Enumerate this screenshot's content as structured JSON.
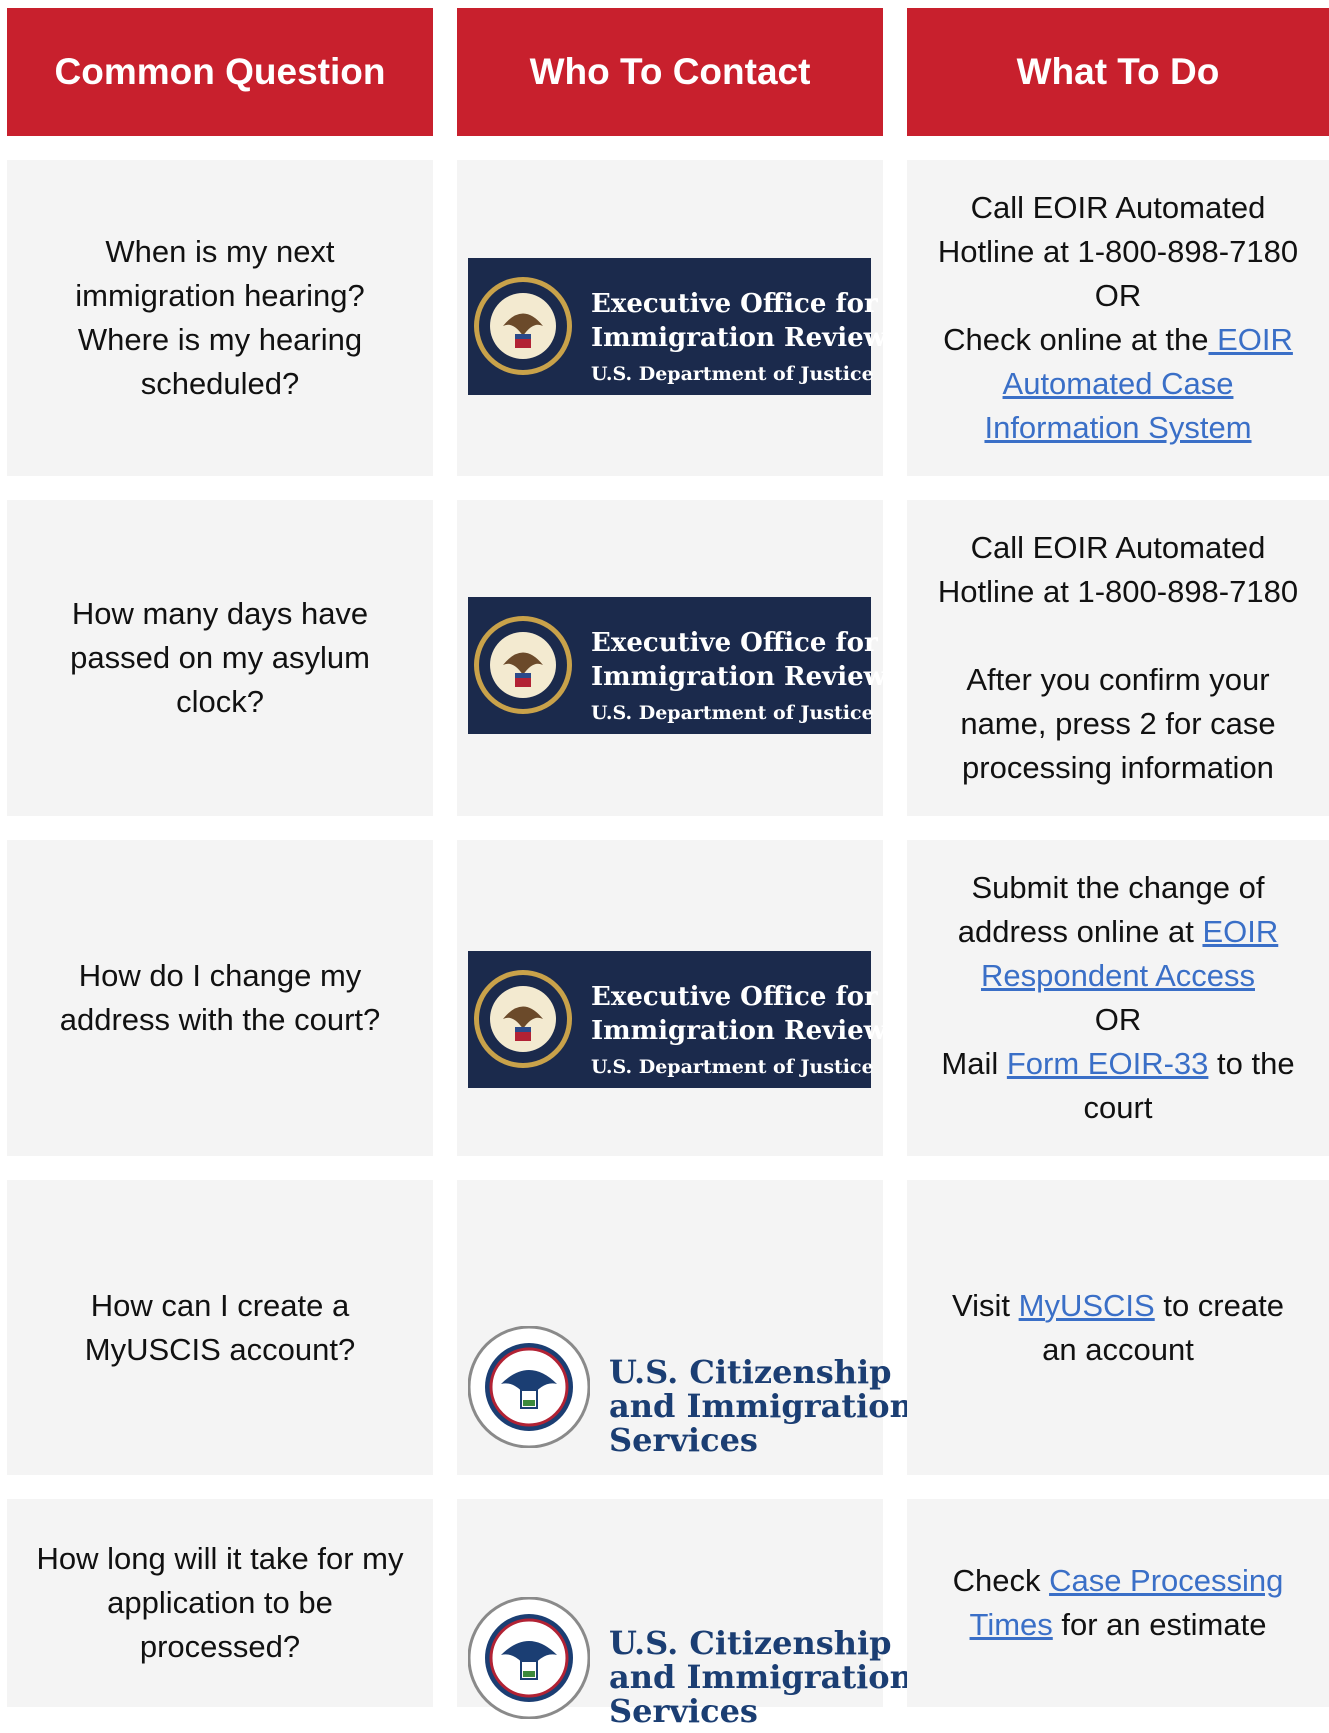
{
  "headers": {
    "question": "Common Question",
    "contact": "Who To Contact",
    "action": "What To Do"
  },
  "logos": {
    "eoir": {
      "line1": "Executive Office for",
      "line2": "Immigration Review",
      "line3": "U.S. Department of Justice",
      "bg_color": "#1b2a4c"
    },
    "uscis": {
      "line1": "U.S. Citizenship",
      "line2": "and Immigration",
      "line3": "Services",
      "text_color": "#1b3e73"
    }
  },
  "colors": {
    "header_red": "#c8202d",
    "link_blue": "#3a6fc7",
    "cell_bg": "#f4f4f4"
  },
  "rows": [
    {
      "question": [
        "When is my next",
        "immigration hearing?",
        "Where is my hearing",
        "scheduled?"
      ],
      "contact": "eoir",
      "action": {
        "l1": "Call EOIR Automated",
        "l2": "Hotline at 1-800-898-7180",
        "l3": "OR",
        "l4_text": "Check online at the",
        "l4_link": " EOIR",
        "l5_link": "Automated Case",
        "l6_link": "Information System"
      }
    },
    {
      "question": [
        "How many days have",
        "passed on my asylum",
        "clock?"
      ],
      "contact": "eoir",
      "action": {
        "l1": "Call EOIR Automated",
        "l2": "Hotline at 1-800-898-7180",
        "l3": "After you confirm your",
        "l4": "name, press 2 for case",
        "l5": "processing information"
      }
    },
    {
      "question": [
        "How do I change my",
        "address with the court?"
      ],
      "contact": "eoir",
      "action": {
        "l1": "Submit the change of",
        "l2_text": "address online at ",
        "l2_link": "EOIR",
        "l3_link": "Respondent Access",
        "l4": "OR",
        "l5_pre": "Mail ",
        "l5_link": "Form EOIR-33",
        "l5_post": " to the",
        "l6": "court"
      }
    },
    {
      "question": [
        "How can I create a",
        "MyUSCIS account?"
      ],
      "contact": "uscis",
      "action": {
        "l1_pre": "Visit ",
        "l1_link": "MyUSCIS",
        "l1_post": " to create",
        "l2": "an account"
      }
    },
    {
      "question": [
        "How long will it take for my",
        "application to be",
        "processed?"
      ],
      "contact": "uscis",
      "action": {
        "l1_pre": "Check ",
        "l1_link": "Case Processing",
        "l2_link": "Times",
        "l2_post": " for an estimate"
      }
    }
  ]
}
